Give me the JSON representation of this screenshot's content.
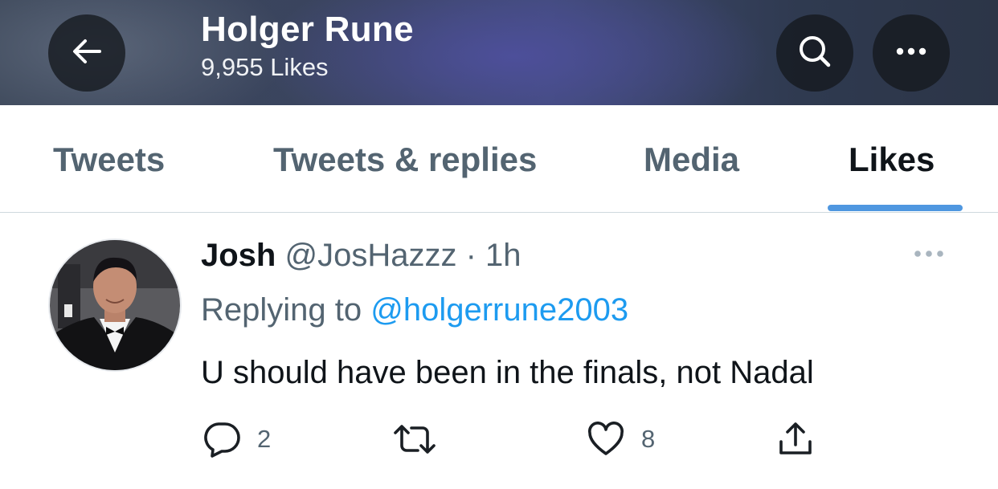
{
  "header": {
    "title": "Holger Rune",
    "subtitle": "9,955 Likes",
    "icons": {
      "back": "arrow-left-icon",
      "search": "search-icon",
      "more": "more-horizontal-icon"
    }
  },
  "tabs": [
    {
      "label": "Tweets",
      "active": false
    },
    {
      "label": "Tweets & replies",
      "active": false
    },
    {
      "label": "Media",
      "active": false
    },
    {
      "label": "Likes",
      "active": true
    }
  ],
  "tweet": {
    "name": "Josh",
    "handle": "@JosHazzz",
    "separator": "·",
    "time": "1h",
    "replying_prefix": "Replying to",
    "replying_to": "@holgerrune2003",
    "text": "U should have been in the finals, not Nadal",
    "counts": {
      "replies": "2",
      "likes": "8"
    },
    "icons": {
      "reply": "reply-icon",
      "retweet": "retweet-icon",
      "like": "heart-icon",
      "share": "share-icon",
      "more": "more-horizontal-icon"
    }
  },
  "colors": {
    "accent": "#1d9bf0",
    "tab_indicator": "#4f97e0",
    "muted_text": "#536471",
    "primary_text": "#0f1419"
  }
}
